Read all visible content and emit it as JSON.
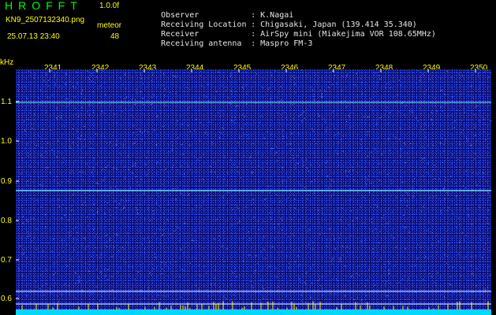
{
  "header": {
    "app_name": "HROFFT",
    "version": "1.0.0f",
    "filename": "KN9_2507132340.png",
    "meteor_label": "meteor",
    "datetime": "25.07.13 23:40",
    "meteor_count": "48"
  },
  "info": [
    {
      "label": "Observer",
      "value": ": K.Nagai"
    },
    {
      "label": "Receiving Location",
      "value": ": Chigasaki, Japan (139.414 35.340)"
    },
    {
      "label": "Receiver",
      "value": ": AirSpy mini (Miakejima VOR 108.65MHz)"
    },
    {
      "label": "Receiving antenna",
      "value": ": Maspro FM-3"
    }
  ],
  "axis": {
    "y_unit": "kHz",
    "x_ticks": [
      "2341",
      "2342",
      "2343",
      "2344",
      "2345",
      "2346",
      "2347",
      "2348",
      "2349",
      "2350"
    ],
    "y_ticks": [
      "1.1",
      "1.0",
      "0.9",
      "0.8",
      "0.7",
      "0.6"
    ]
  },
  "colors": {
    "background": "#000000",
    "plot_background": "#0a0f7a",
    "label_yellow": "#ffff00",
    "logo_green": "#00ff00",
    "signal_cyan": "#7fe8ff",
    "bottom_bar": "#00d8ff"
  }
}
